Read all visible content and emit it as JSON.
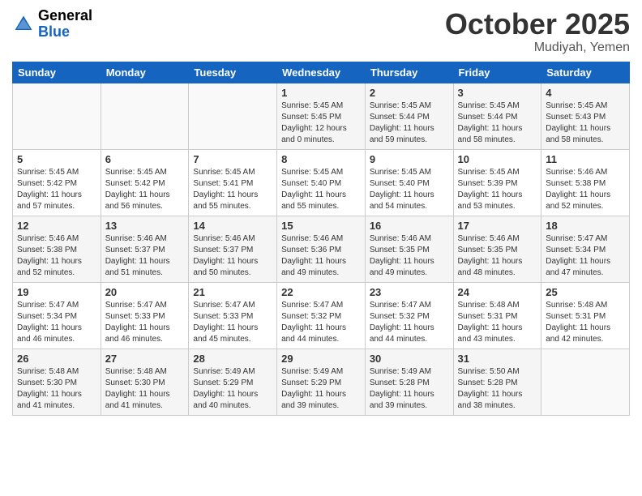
{
  "logo": {
    "general": "General",
    "blue": "Blue"
  },
  "header": {
    "title": "October 2025",
    "location": "Mudiyah, Yemen"
  },
  "days": [
    "Sunday",
    "Monday",
    "Tuesday",
    "Wednesday",
    "Thursday",
    "Friday",
    "Saturday"
  ],
  "weeks": [
    [
      {
        "day": "",
        "sunrise": "",
        "sunset": "",
        "daylight": ""
      },
      {
        "day": "",
        "sunrise": "",
        "sunset": "",
        "daylight": ""
      },
      {
        "day": "",
        "sunrise": "",
        "sunset": "",
        "daylight": ""
      },
      {
        "day": "1",
        "sunrise": "Sunrise: 5:45 AM",
        "sunset": "Sunset: 5:45 PM",
        "daylight": "Daylight: 12 hours and 0 minutes."
      },
      {
        "day": "2",
        "sunrise": "Sunrise: 5:45 AM",
        "sunset": "Sunset: 5:44 PM",
        "daylight": "Daylight: 11 hours and 59 minutes."
      },
      {
        "day": "3",
        "sunrise": "Sunrise: 5:45 AM",
        "sunset": "Sunset: 5:44 PM",
        "daylight": "Daylight: 11 hours and 58 minutes."
      },
      {
        "day": "4",
        "sunrise": "Sunrise: 5:45 AM",
        "sunset": "Sunset: 5:43 PM",
        "daylight": "Daylight: 11 hours and 58 minutes."
      }
    ],
    [
      {
        "day": "5",
        "sunrise": "Sunrise: 5:45 AM",
        "sunset": "Sunset: 5:42 PM",
        "daylight": "Daylight: 11 hours and 57 minutes."
      },
      {
        "day": "6",
        "sunrise": "Sunrise: 5:45 AM",
        "sunset": "Sunset: 5:42 PM",
        "daylight": "Daylight: 11 hours and 56 minutes."
      },
      {
        "day": "7",
        "sunrise": "Sunrise: 5:45 AM",
        "sunset": "Sunset: 5:41 PM",
        "daylight": "Daylight: 11 hours and 55 minutes."
      },
      {
        "day": "8",
        "sunrise": "Sunrise: 5:45 AM",
        "sunset": "Sunset: 5:40 PM",
        "daylight": "Daylight: 11 hours and 55 minutes."
      },
      {
        "day": "9",
        "sunrise": "Sunrise: 5:45 AM",
        "sunset": "Sunset: 5:40 PM",
        "daylight": "Daylight: 11 hours and 54 minutes."
      },
      {
        "day": "10",
        "sunrise": "Sunrise: 5:45 AM",
        "sunset": "Sunset: 5:39 PM",
        "daylight": "Daylight: 11 hours and 53 minutes."
      },
      {
        "day": "11",
        "sunrise": "Sunrise: 5:46 AM",
        "sunset": "Sunset: 5:38 PM",
        "daylight": "Daylight: 11 hours and 52 minutes."
      }
    ],
    [
      {
        "day": "12",
        "sunrise": "Sunrise: 5:46 AM",
        "sunset": "Sunset: 5:38 PM",
        "daylight": "Daylight: 11 hours and 52 minutes."
      },
      {
        "day": "13",
        "sunrise": "Sunrise: 5:46 AM",
        "sunset": "Sunset: 5:37 PM",
        "daylight": "Daylight: 11 hours and 51 minutes."
      },
      {
        "day": "14",
        "sunrise": "Sunrise: 5:46 AM",
        "sunset": "Sunset: 5:37 PM",
        "daylight": "Daylight: 11 hours and 50 minutes."
      },
      {
        "day": "15",
        "sunrise": "Sunrise: 5:46 AM",
        "sunset": "Sunset: 5:36 PM",
        "daylight": "Daylight: 11 hours and 49 minutes."
      },
      {
        "day": "16",
        "sunrise": "Sunrise: 5:46 AM",
        "sunset": "Sunset: 5:35 PM",
        "daylight": "Daylight: 11 hours and 49 minutes."
      },
      {
        "day": "17",
        "sunrise": "Sunrise: 5:46 AM",
        "sunset": "Sunset: 5:35 PM",
        "daylight": "Daylight: 11 hours and 48 minutes."
      },
      {
        "day": "18",
        "sunrise": "Sunrise: 5:47 AM",
        "sunset": "Sunset: 5:34 PM",
        "daylight": "Daylight: 11 hours and 47 minutes."
      }
    ],
    [
      {
        "day": "19",
        "sunrise": "Sunrise: 5:47 AM",
        "sunset": "Sunset: 5:34 PM",
        "daylight": "Daylight: 11 hours and 46 minutes."
      },
      {
        "day": "20",
        "sunrise": "Sunrise: 5:47 AM",
        "sunset": "Sunset: 5:33 PM",
        "daylight": "Daylight: 11 hours and 46 minutes."
      },
      {
        "day": "21",
        "sunrise": "Sunrise: 5:47 AM",
        "sunset": "Sunset: 5:33 PM",
        "daylight": "Daylight: 11 hours and 45 minutes."
      },
      {
        "day": "22",
        "sunrise": "Sunrise: 5:47 AM",
        "sunset": "Sunset: 5:32 PM",
        "daylight": "Daylight: 11 hours and 44 minutes."
      },
      {
        "day": "23",
        "sunrise": "Sunrise: 5:47 AM",
        "sunset": "Sunset: 5:32 PM",
        "daylight": "Daylight: 11 hours and 44 minutes."
      },
      {
        "day": "24",
        "sunrise": "Sunrise: 5:48 AM",
        "sunset": "Sunset: 5:31 PM",
        "daylight": "Daylight: 11 hours and 43 minutes."
      },
      {
        "day": "25",
        "sunrise": "Sunrise: 5:48 AM",
        "sunset": "Sunset: 5:31 PM",
        "daylight": "Daylight: 11 hours and 42 minutes."
      }
    ],
    [
      {
        "day": "26",
        "sunrise": "Sunrise: 5:48 AM",
        "sunset": "Sunset: 5:30 PM",
        "daylight": "Daylight: 11 hours and 41 minutes."
      },
      {
        "day": "27",
        "sunrise": "Sunrise: 5:48 AM",
        "sunset": "Sunset: 5:30 PM",
        "daylight": "Daylight: 11 hours and 41 minutes."
      },
      {
        "day": "28",
        "sunrise": "Sunrise: 5:49 AM",
        "sunset": "Sunset: 5:29 PM",
        "daylight": "Daylight: 11 hours and 40 minutes."
      },
      {
        "day": "29",
        "sunrise": "Sunrise: 5:49 AM",
        "sunset": "Sunset: 5:29 PM",
        "daylight": "Daylight: 11 hours and 39 minutes."
      },
      {
        "day": "30",
        "sunrise": "Sunrise: 5:49 AM",
        "sunset": "Sunset: 5:28 PM",
        "daylight": "Daylight: 11 hours and 39 minutes."
      },
      {
        "day": "31",
        "sunrise": "Sunrise: 5:50 AM",
        "sunset": "Sunset: 5:28 PM",
        "daylight": "Daylight: 11 hours and 38 minutes."
      },
      {
        "day": "",
        "sunrise": "",
        "sunset": "",
        "daylight": ""
      }
    ]
  ]
}
